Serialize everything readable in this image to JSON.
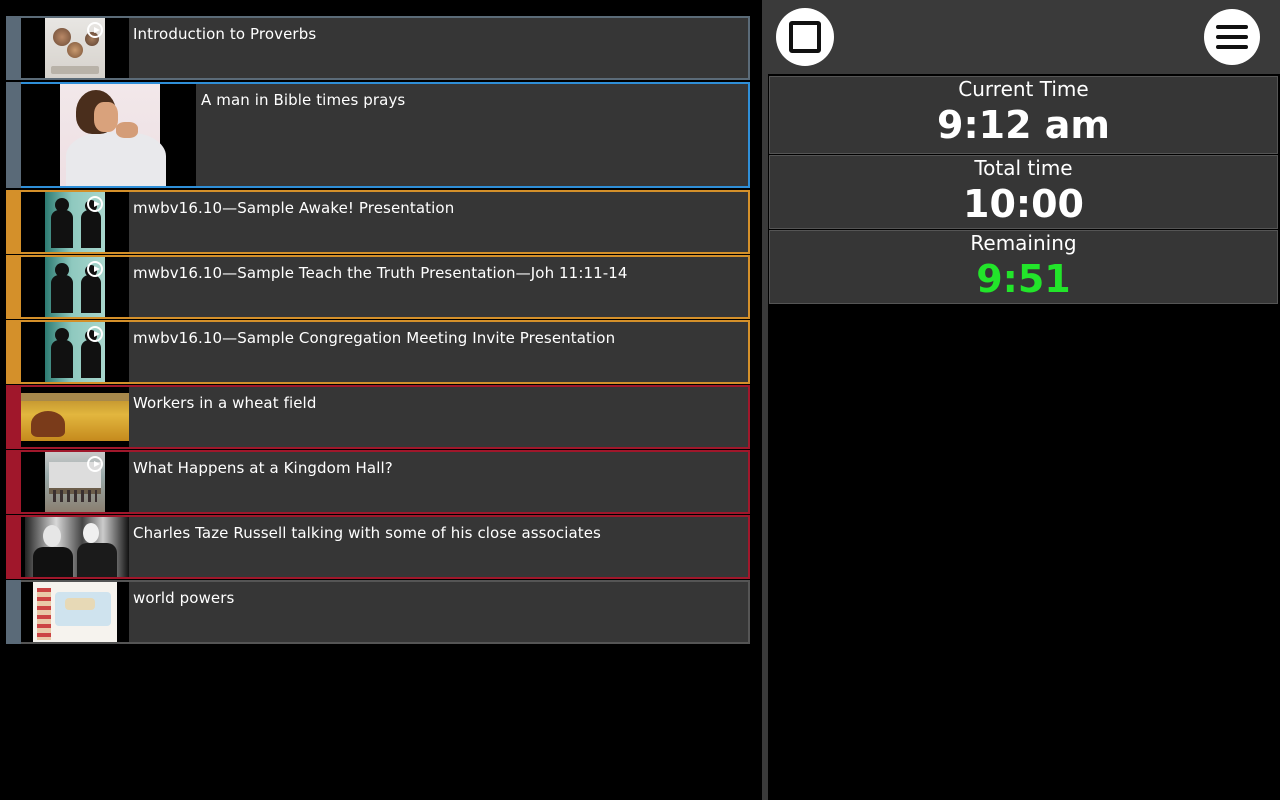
{
  "media_list": {
    "items": [
      {
        "title": "Introduction to Proverbs",
        "accent": "#5a6a78",
        "border": "#5b6b78",
        "video": true
      },
      {
        "title": "A man in Bible times prays",
        "accent": "#5a6a78",
        "border": "#2f8fd8",
        "video": false,
        "selected": true
      },
      {
        "title": "mwbv16.10—Sample Awake! Presentation",
        "accent": "#d4902a",
        "border": "#d4902a",
        "video": true
      },
      {
        "title": "mwbv16.10—Sample Teach the Truth Presentation—Joh 11:11-14",
        "accent": "#d4902a",
        "border": "#d4902a",
        "video": true
      },
      {
        "title": "mwbv16.10—Sample Congregation Meeting Invite Presentation",
        "accent": "#d4902a",
        "border": "#d4902a",
        "video": true
      },
      {
        "title": "Workers in a wheat field",
        "accent": "#a0172b",
        "border": "#a0172b",
        "video": false
      },
      {
        "title": "What Happens at a Kingdom Hall?",
        "accent": "#a0172b",
        "border": "#a0172b",
        "video": true
      },
      {
        "title": "Charles Taze Russell talking with some of his close associates",
        "accent": "#a0172b",
        "border": "#a0172b",
        "video": false
      },
      {
        "title": "world powers",
        "accent": "#5a6a78",
        "border": "#555555",
        "video": false
      }
    ]
  },
  "timer": {
    "current_time_label": "Current Time",
    "current_time_value": "9:12 am",
    "total_time_label": "Total time",
    "total_time_value": "10:00",
    "remaining_label": "Remaining",
    "remaining_value": "9:51",
    "remaining_color": "#22e52a"
  },
  "icons": {
    "stop": "stop-icon",
    "menu": "hamburger-menu-icon",
    "play": "play-circle-icon"
  }
}
